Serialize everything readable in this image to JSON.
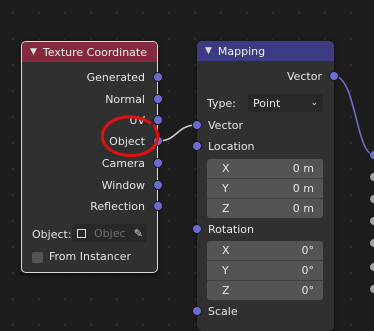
{
  "texture_node": {
    "title": "Texture Coordinate",
    "outputs": [
      "Generated",
      "Normal",
      "UV",
      "Object",
      "Camera",
      "Window",
      "Reflection"
    ],
    "object_label": "Object:",
    "object_placeholder": "Objec",
    "instancer_label": "From Instancer"
  },
  "mapping_node": {
    "title": "Mapping",
    "output_label": "Vector",
    "type_label": "Type:",
    "type_value": "Point",
    "inputs": {
      "vector": "Vector",
      "location": "Location",
      "rotation": "Rotation",
      "scale": "Scale"
    },
    "location": [
      {
        "axis": "X",
        "value": "0 m"
      },
      {
        "axis": "Y",
        "value": "0 m"
      },
      {
        "axis": "Z",
        "value": "0 m"
      }
    ],
    "rotation": [
      {
        "axis": "X",
        "value": "0°"
      },
      {
        "axis": "Y",
        "value": "0°"
      },
      {
        "axis": "Z",
        "value": "0°"
      }
    ]
  },
  "colors": {
    "texture_header": "#852a3e",
    "mapping_header": "#3d3b83",
    "vector_socket": "#6c6cd0",
    "gray_socket": "#a1a1a1",
    "annotation": "#e01010"
  }
}
